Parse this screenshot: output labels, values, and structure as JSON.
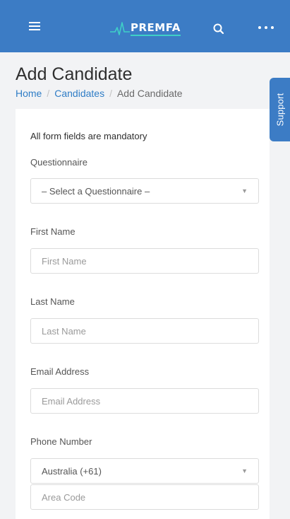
{
  "header": {
    "logo_text": "PREMFA",
    "menu_icon": "hamburger-menu-icon",
    "search_icon": "search-icon",
    "more_icon": "more-dots-icon"
  },
  "page": {
    "title": "Add Candidate",
    "breadcrumb": [
      "Home",
      "Candidates",
      "Add Candidate"
    ],
    "breadcrumb_separator": "/"
  },
  "support_tab": "Support",
  "form": {
    "note": "All form fields are mandatory",
    "questionnaire": {
      "label": "Questionnaire",
      "value": "– Select a Questionnaire –"
    },
    "first_name": {
      "label": "First Name",
      "placeholder": "First Name",
      "value": ""
    },
    "last_name": {
      "label": "Last Name",
      "placeholder": "Last Name",
      "value": ""
    },
    "email": {
      "label": "Email Address",
      "placeholder": "Email Address",
      "value": ""
    },
    "phone": {
      "label": "Phone Number",
      "country": "Australia (+61)",
      "area_code_placeholder": "Area Code"
    }
  },
  "colors": {
    "header_bg": "#3c7cc5",
    "link": "#2f7dc6",
    "logo_accent": "#3fd0c6"
  }
}
